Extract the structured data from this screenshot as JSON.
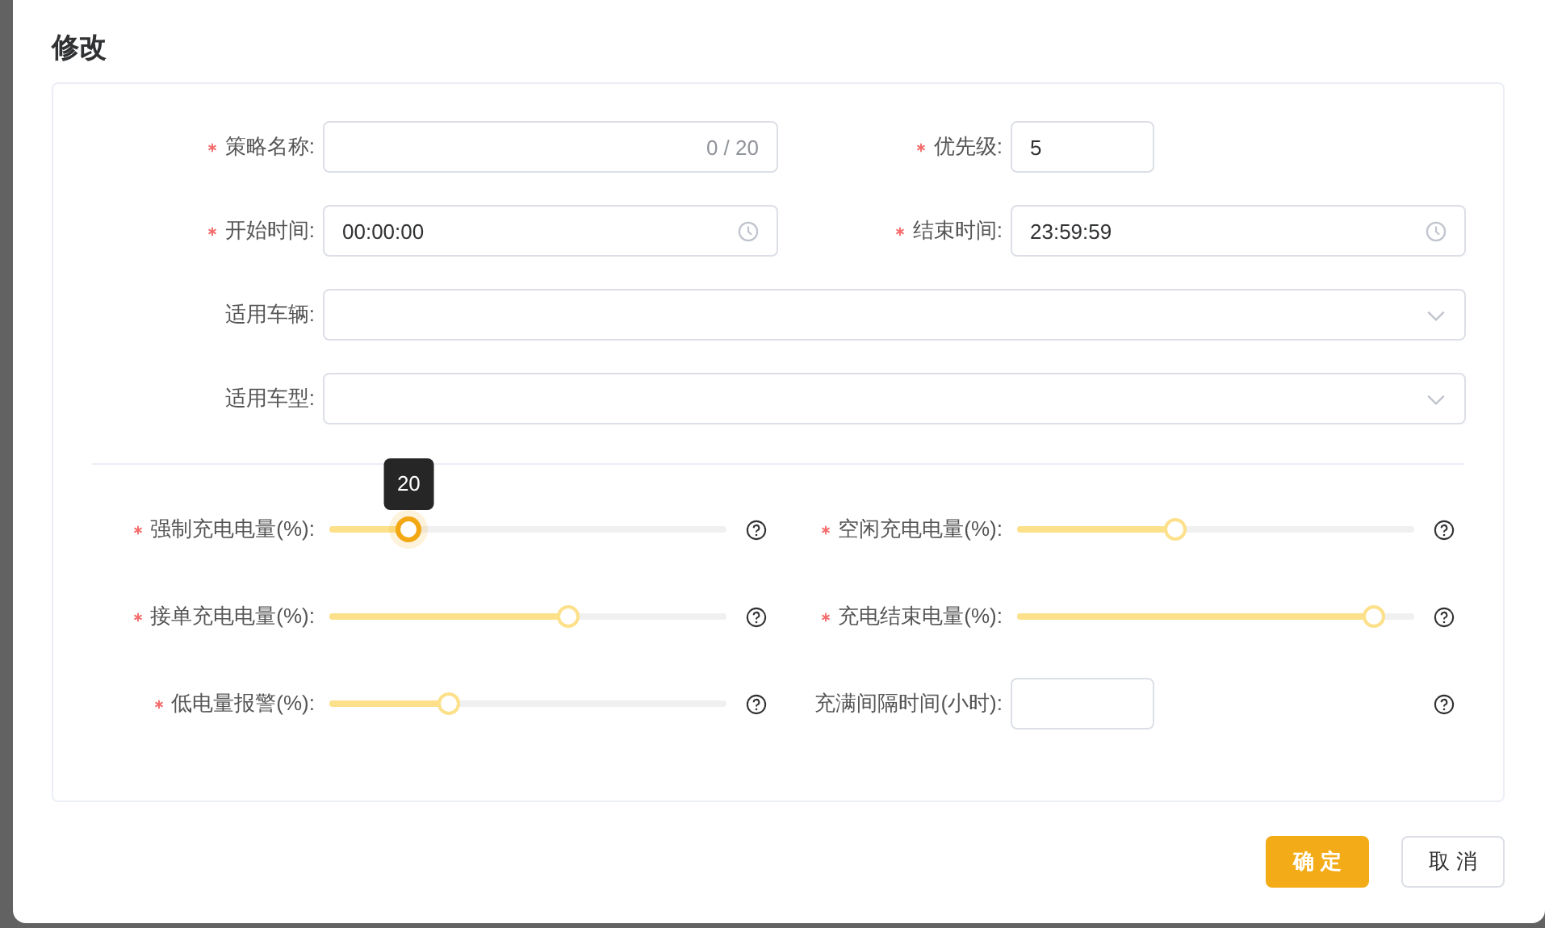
{
  "dialog": {
    "title": "修改"
  },
  "fields": [
    {
      "kind": "text",
      "label": "策略名称:",
      "required": true,
      "counter": "0 / 20"
    },
    {
      "kind": "number",
      "label": "优先级:",
      "required": true,
      "value": "5"
    },
    {
      "kind": "time",
      "label": "开始时间:",
      "required": true,
      "value": "00:00:00"
    },
    {
      "kind": "time",
      "label": "结束时间:",
      "required": true,
      "value": "23:59:59"
    },
    {
      "kind": "select",
      "label": "适用车辆:",
      "required": false
    },
    {
      "kind": "select",
      "label": "适用车型:",
      "required": false
    }
  ],
  "sliders": [
    {
      "kind": "slider",
      "label": "强制充电电量(%):",
      "required": true,
      "level": 0.2,
      "tooltip": "20"
    },
    {
      "kind": "slider",
      "label": "空闲充电电量(%):",
      "required": true,
      "level": 0.4
    },
    {
      "kind": "slider",
      "label": "接单充电电量(%):",
      "required": true,
      "level": 0.6
    },
    {
      "kind": "slider",
      "label": "充电结束电量(%):",
      "required": true,
      "level": 0.9
    },
    {
      "kind": "slider",
      "label": "低电量报警(%):",
      "required": true,
      "level": 0.3
    },
    {
      "kind": "number",
      "label": "充满间隔时间(小时):",
      "required": false
    }
  ],
  "buttons": [
    {
      "label": "确 定",
      "kind": "primary"
    },
    {
      "label": "取 消",
      "kind": "default"
    }
  ]
}
